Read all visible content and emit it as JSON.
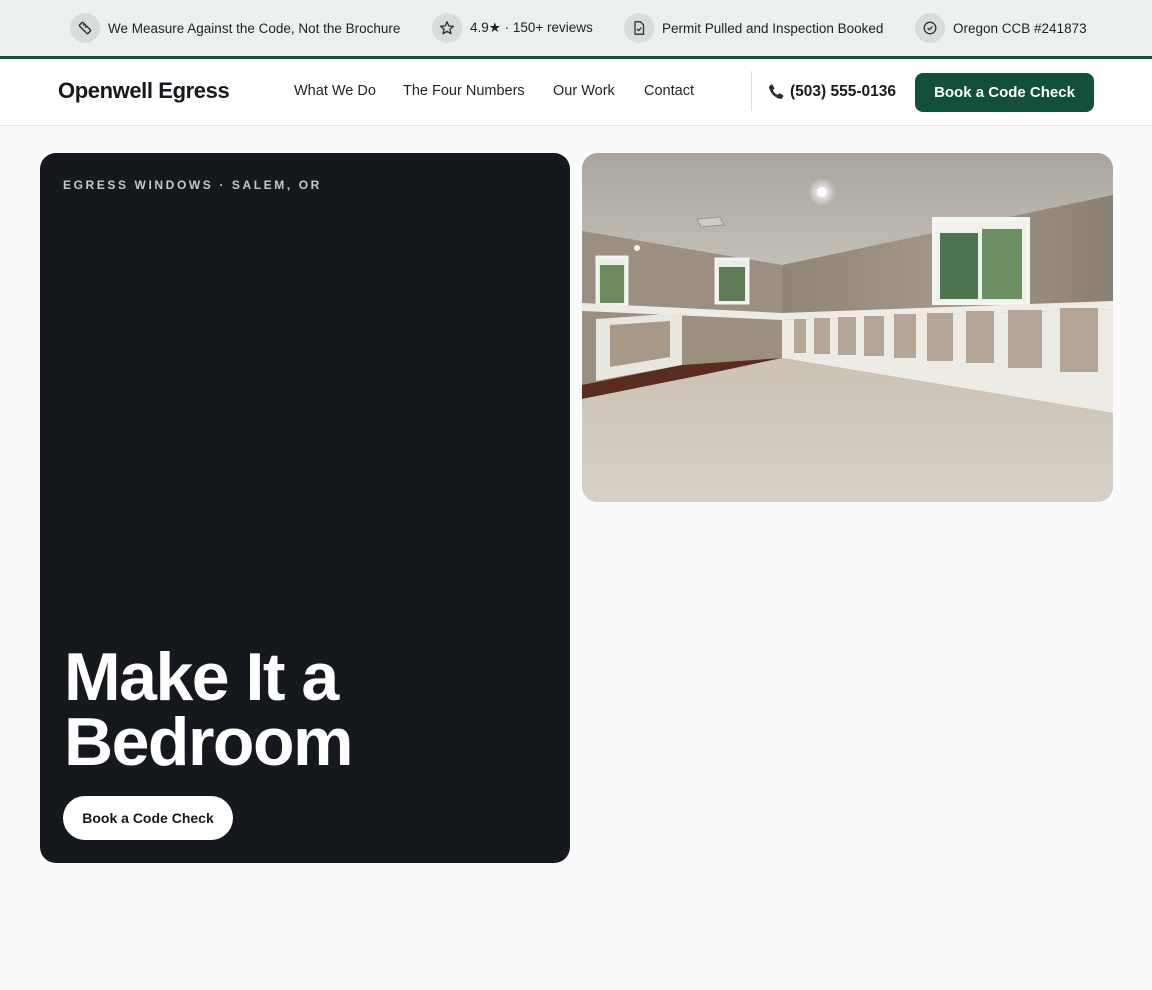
{
  "trust_bar": {
    "items": [
      {
        "icon": "ruler-icon",
        "text": "We Measure Against the Code, Not the Brochure"
      },
      {
        "icon": "star-icon",
        "text": "4.9★ · 150+ reviews"
      },
      {
        "icon": "document-check-icon",
        "text": "Permit Pulled and Inspection Booked"
      },
      {
        "icon": "check-circle-icon",
        "text": "Oregon CCB #241873"
      }
    ],
    "accent_color": "#124f3d"
  },
  "nav": {
    "logo": "Openwell Egress",
    "links": [
      {
        "label": "What We Do"
      },
      {
        "label": "The Four Numbers"
      },
      {
        "label": "Our Work"
      },
      {
        "label": "Contact"
      }
    ],
    "phone": "(503) 555-0136",
    "cta_label": "Book a Code Check"
  },
  "hero": {
    "eyebrow": "EGRESS WINDOWS · SALEM, OR",
    "title": "Make It a Bedroom",
    "cta_label": "Book a Code Check",
    "card_color": "#15181d"
  },
  "colors": {
    "brand_green": "#124f3d",
    "page_background": "#fafafa",
    "trust_bar_background": "#ebefed"
  }
}
